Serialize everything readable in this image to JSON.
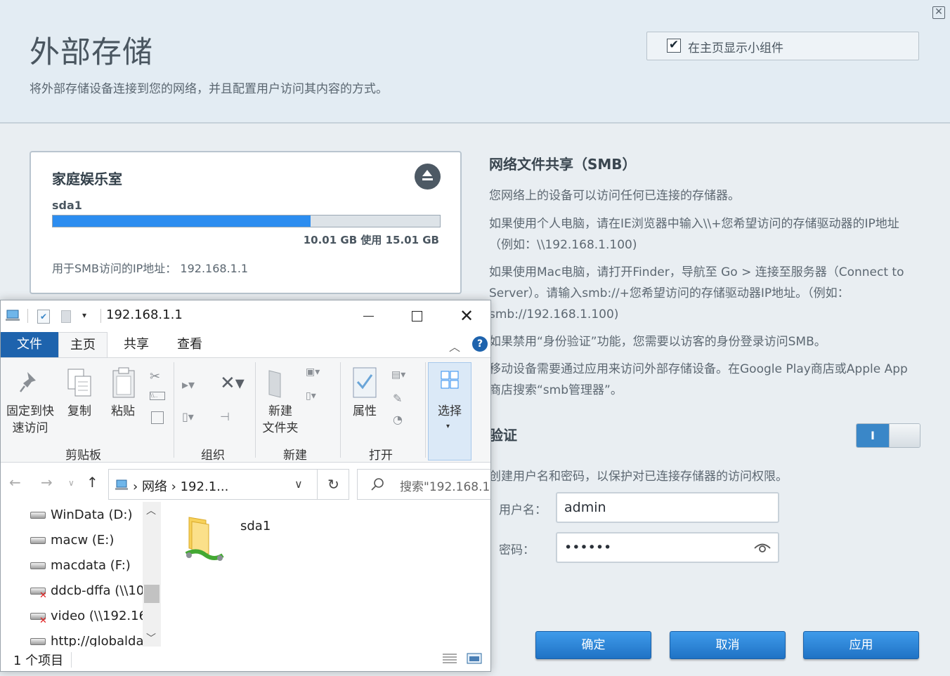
{
  "header": {
    "title": "外部存储",
    "subtitle": "将外部存储设备连接到您的网络，并且配置用户访问其内容的方式。",
    "widget_label": "在主页显示小组件",
    "widget_checked": true
  },
  "device": {
    "name": "家庭娱乐室",
    "drive": "sda1",
    "usage_fraction": 0.666,
    "usage_text": "10.01 GB 使用 15.01 GB",
    "smb_ip_label": "用于SMB访问的IP地址：",
    "smb_ip": "192.168.1.1"
  },
  "smb": {
    "title": "网络文件共享（SMB）",
    "p1": "您网络上的设备可以访问任何已连接的存储器。",
    "p2": "如果使用个人电脑，请在IE浏览器中输入\\\\+您希望访问的存储驱动器的IP地址（例如：\\\\192.168.1.100)",
    "p3": "如果使用Mac电脑，请打开Finder，导航至 Go > 连接至服务器（Connect to Server）。请输入smb://+您希望访问的存储驱动器IP地址。（例如：smb://192.168.1.100)",
    "p4": "如果禁用“身份验证”功能，您需要以访客的身份登录访问SMB。",
    "p5": "移动设备需要通过应用来访问外部存储设备。在Google Play商店或Apple App 商店搜索“smb管理器”。"
  },
  "auth": {
    "title": "验证",
    "toggle_on_label": "I",
    "description": "创建用户名和密码，以保护对已连接存储器的访问权限。",
    "username_label": "用户名：",
    "username_value": "admin",
    "password_label": "密码：",
    "password_value": "••••••"
  },
  "buttons": {
    "ok": "确定",
    "cancel": "取消",
    "apply": "应用"
  },
  "explorer": {
    "title": "192.168.1.1",
    "tabs": {
      "file": "文件",
      "home": "主页",
      "share": "共享",
      "view": "查看"
    },
    "ribbon": {
      "pin_label_1": "固定到快",
      "pin_label_2": "速访问",
      "copy": "复制",
      "paste": "粘贴",
      "clipboard_group": "剪贴板",
      "organize_group": "组织",
      "new_folder_1": "新建",
      "new_folder_2": "文件夹",
      "new_group": "新建",
      "properties": "属性",
      "open_group": "打开",
      "select": "选择"
    },
    "address": {
      "crumb_network": "网络",
      "crumb_current": "192.1...",
      "separator": "›"
    },
    "search_placeholder": "搜索\"192.168.1",
    "tree": [
      {
        "label": "WinData (D:)",
        "disconnected": false
      },
      {
        "label": "macw (E:)",
        "disconnected": false
      },
      {
        "label": "macdata (F:)",
        "disconnected": false
      },
      {
        "label": "ddcb-dffa (\\\\10",
        "disconnected": true
      },
      {
        "label": "video (\\\\192.16",
        "disconnected": true
      },
      {
        "label": "http://globalda",
        "disconnected": false
      }
    ],
    "items": [
      {
        "name": "sda1"
      }
    ],
    "status": "1 个项目"
  }
}
